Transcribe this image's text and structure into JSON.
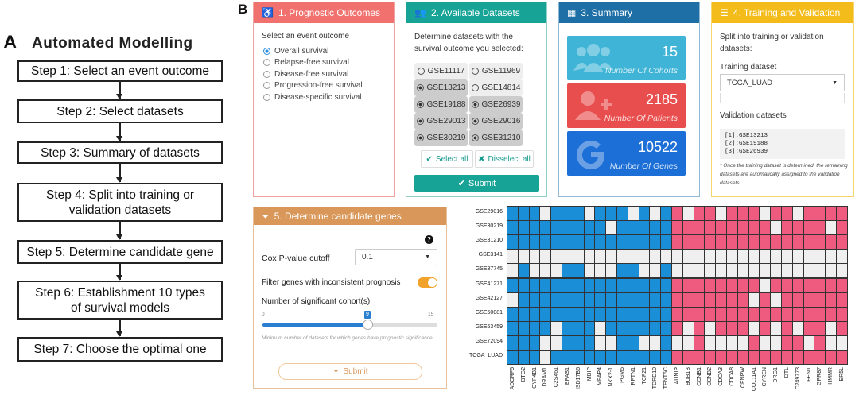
{
  "panelA": {
    "letter": "A",
    "title": "Automated Modelling",
    "steps": [
      "Step 1: Select an event outcome",
      "Step 2: Select datasets",
      "Step 3: Summary of datasets",
      "Step 4: Split into training or validation datasets",
      "Step 5: Determine candidate gene",
      "Step 6: Establishment 10 types of survival models",
      "Step 7: Choose the optimal one"
    ]
  },
  "panelB": {
    "letter": "B",
    "prognostic": {
      "title": "1. Prognostic Outcomes",
      "prompt": "Select an event outcome",
      "options": [
        "Overall survival",
        "Relapse-free survival",
        "Disease-free survival",
        "Progression-free survival",
        "Disease-specific survival"
      ],
      "selected_index": 0,
      "color": "#f0716e"
    },
    "datasets": {
      "title": "2. Available Datasets",
      "prompt": "Determine datasets with the survival outcome you selected:",
      "items": [
        {
          "name": "GSE11117",
          "selected": false
        },
        {
          "name": "GSE11969",
          "selected": false
        },
        {
          "name": "GSE13213",
          "selected": true
        },
        {
          "name": "GSE14814",
          "selected": false
        },
        {
          "name": "GSE19188",
          "selected": true
        },
        {
          "name": "GSE26939",
          "selected": true
        },
        {
          "name": "GSE29013",
          "selected": true
        },
        {
          "name": "GSE29016",
          "selected": true
        },
        {
          "name": "GSE30219",
          "selected": true
        },
        {
          "name": "GSE31210",
          "selected": true
        }
      ],
      "select_all": "Select all",
      "deselect_all": "Disselect all",
      "submit": "Submit",
      "color": "#17a396"
    },
    "summary": {
      "title": "3. Summary",
      "tiles": [
        {
          "value": "15",
          "label": "Number Of Cohorts",
          "color": "#3fb4d6",
          "icon": "users-icon"
        },
        {
          "value": "2185",
          "label": "Number Of Patients",
          "color": "#e94e4e",
          "icon": "user-plus-icon"
        },
        {
          "value": "10522",
          "label": "Number Of Genes",
          "color": "#1b6fd6",
          "icon": "google-icon"
        }
      ],
      "color": "#1d6fa5"
    },
    "training": {
      "title": "4. Training and Validation",
      "prompt": "Split into training or validation datasets:",
      "training_label": "Training dataset",
      "training_value": "TCGA_LUAD",
      "validation_label": "Validation datasets",
      "validation_list": [
        "[1]:GSE13213",
        "[2]:GSE19188",
        "[3]:GSE26939"
      ],
      "note": "* Once the training dataset is determined, the remaining datasets are automatically assigned to the validation datasets.",
      "color": "#f3bc1b"
    },
    "candidate": {
      "title": "5. Determine candidate genes",
      "help": "?",
      "cox_label": "Cox P-value cutoff",
      "cox_value": "0.1",
      "filter_label": "Filter genes with inconsistent prognosis",
      "filter_on": true,
      "cohort_label": "Number of significant cohort(s)",
      "slider_min": "0",
      "slider_max": "15",
      "slider_value": 9,
      "slider_value_text": "9",
      "hint": "Minimum number of datasets for which genes have prognostic significance",
      "submit": "Submit",
      "color": "#d9975a"
    },
    "heatmap": {
      "rows": [
        "GSE29016",
        "GSE30219",
        "GSE31210",
        "GSE3141",
        "GSE37745",
        "GSE41271",
        "GSE42127",
        "GSE50081",
        "GSE63459",
        "GSE72094",
        "TCGA_LUAD"
      ],
      "genes": [
        "ADORF5",
        "BTG2",
        "CYP4B1",
        "DRAM1",
        "C2S461",
        "EPAS1",
        "ISD17B6",
        "MBIP",
        "MFAP4",
        "NKX2-1",
        "PGM5",
        "RFTN1",
        "TCF21",
        "TDRD10",
        "TENT5C",
        "AUNIP",
        "BUB1B",
        "CCNB1",
        "CCNB2",
        "CDCA3",
        "CDCA8",
        "CENPW",
        "COL11A1",
        "CYREN",
        "DRG1",
        "DTL",
        "C249773",
        "FEN1",
        "GPR87",
        "HMMR",
        "IER5L"
      ],
      "blue": "#1a8fd8",
      "pink": "#ef5a7f",
      "grey": "#efefef",
      "matrix": [
        [
          1,
          1,
          1,
          0,
          1,
          1,
          1,
          0,
          1,
          1,
          1,
          0,
          1,
          0,
          1,
          2,
          0,
          2,
          2,
          0,
          2,
          2,
          2,
          0,
          2,
          2,
          0,
          2,
          2,
          2,
          2
        ],
        [
          1,
          1,
          1,
          1,
          1,
          1,
          1,
          1,
          1,
          0,
          1,
          1,
          1,
          1,
          1,
          2,
          2,
          2,
          2,
          2,
          2,
          2,
          2,
          2,
          0,
          2,
          2,
          2,
          2,
          0,
          2
        ],
        [
          1,
          1,
          1,
          1,
          1,
          1,
          1,
          1,
          1,
          1,
          1,
          1,
          1,
          1,
          1,
          2,
          2,
          2,
          2,
          2,
          2,
          2,
          2,
          2,
          2,
          2,
          2,
          2,
          2,
          2,
          2
        ],
        [
          0,
          0,
          0,
          0,
          0,
          0,
          0,
          0,
          0,
          0,
          0,
          0,
          0,
          0,
          0,
          0,
          0,
          0,
          0,
          0,
          0,
          0,
          0,
          0,
          0,
          0,
          0,
          0,
          0,
          0,
          0
        ],
        [
          0,
          1,
          0,
          0,
          0,
          1,
          1,
          0,
          0,
          0,
          1,
          1,
          0,
          0,
          1,
          0,
          0,
          0,
          0,
          0,
          0,
          0,
          0,
          0,
          0,
          0,
          0,
          0,
          0,
          0,
          0
        ],
        [
          1,
          1,
          1,
          1,
          1,
          1,
          1,
          1,
          1,
          1,
          1,
          1,
          1,
          1,
          1,
          2,
          2,
          2,
          2,
          2,
          2,
          2,
          2,
          0,
          2,
          2,
          2,
          2,
          2,
          2,
          2
        ],
        [
          0,
          1,
          1,
          1,
          1,
          1,
          1,
          1,
          1,
          1,
          1,
          1,
          1,
          1,
          1,
          2,
          2,
          2,
          2,
          2,
          2,
          2,
          0,
          2,
          0,
          2,
          2,
          2,
          2,
          2,
          2
        ],
        [
          1,
          1,
          1,
          1,
          1,
          1,
          1,
          1,
          1,
          1,
          1,
          1,
          1,
          1,
          1,
          2,
          2,
          2,
          2,
          2,
          2,
          2,
          2,
          2,
          2,
          2,
          2,
          2,
          2,
          2,
          2
        ],
        [
          1,
          1,
          1,
          1,
          0,
          1,
          1,
          1,
          0,
          1,
          1,
          1,
          1,
          1,
          1,
          2,
          0,
          2,
          0,
          2,
          2,
          2,
          0,
          2,
          0,
          2,
          0,
          2,
          2,
          0,
          2
        ],
        [
          1,
          1,
          1,
          0,
          0,
          1,
          1,
          1,
          0,
          0,
          1,
          1,
          0,
          0,
          1,
          0,
          0,
          2,
          0,
          0,
          0,
          0,
          2,
          0,
          0,
          2,
          2,
          0,
          2,
          0,
          0
        ],
        [
          1,
          1,
          1,
          0,
          1,
          1,
          1,
          1,
          1,
          1,
          1,
          1,
          1,
          1,
          1,
          2,
          2,
          2,
          2,
          2,
          2,
          2,
          2,
          2,
          2,
          2,
          2,
          2,
          2,
          2,
          2
        ]
      ]
    }
  }
}
